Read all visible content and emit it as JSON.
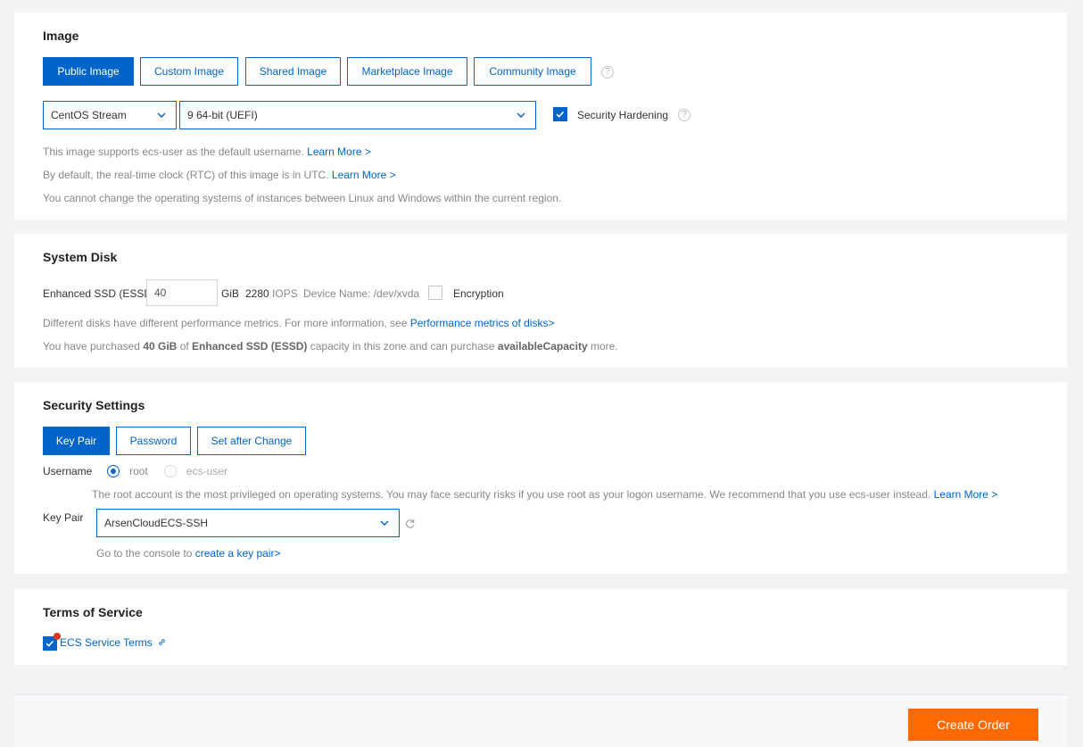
{
  "image": {
    "title": "Image",
    "tabs": [
      {
        "label": "Public Image",
        "active": true
      },
      {
        "label": "Custom Image",
        "active": false
      },
      {
        "label": "Shared Image",
        "active": false
      },
      {
        "label": "Marketplace Image",
        "active": false
      },
      {
        "label": "Community Image",
        "active": false
      }
    ],
    "os_select": "CentOS Stream",
    "version_select": "9 64-bit (UEFI)",
    "security_hardening_label": "Security Hardening",
    "security_hardening_checked": true,
    "note1": "This image supports ecs-user as the default username.",
    "note1_link": "Learn More >",
    "note2": "By default, the real-time clock (RTC) of this image is in UTC.",
    "note2_link": "Learn More >",
    "note3": "You cannot change the operating systems of instances between Linux and Windows within the current region."
  },
  "system_disk": {
    "title": "System Disk",
    "disk_type": "Enhanced SSD (ESSD)",
    "size_value": "40",
    "size_unit": "GiB",
    "iops_value": "2280",
    "iops_unit": "IOPS",
    "device_name": "Device Name: /dev/xvda",
    "encryption_label": "Encryption",
    "encryption_checked": false,
    "note1": "Different disks have different performance metrics. For more information, see",
    "note1_link": "Performance metrics of disks>",
    "note2_pre": "You have purchased",
    "note2_amount": "40 GiB",
    "note2_of": "of",
    "note2_type": "Enhanced SSD (ESSD)",
    "note2_mid": "capacity in this zone and can purchase",
    "note2_avail": "availableCapacity",
    "note2_post": "more."
  },
  "security": {
    "title": "Security Settings",
    "tabs": [
      {
        "label": "Key Pair",
        "active": true
      },
      {
        "label": "Password",
        "active": false
      },
      {
        "label": "Set after Change",
        "active": false
      }
    ],
    "username_label": "Username",
    "username_options": [
      {
        "label": "root",
        "selected": true
      },
      {
        "label": "ecs-user",
        "selected": false
      }
    ],
    "root_warning": "The root account is the most privileged on operating systems. You may face security risks if you use root as your logon username. We recommend that you use ecs-user instead.",
    "root_warning_link": "Learn More >",
    "key_pair_label": "Key Pair",
    "key_pair_value": "ArsenCloudECS-SSH",
    "console_note": "Go to the console to",
    "console_link": "create a key pair>"
  },
  "terms": {
    "title": "Terms of Service",
    "link": "ECS Service Terms",
    "checked": true
  },
  "footer": {
    "create_order_label": "Create Order"
  },
  "colors": {
    "primary": "#0064c8",
    "order_button": "#ff6a00",
    "badge": "#e0341d"
  }
}
